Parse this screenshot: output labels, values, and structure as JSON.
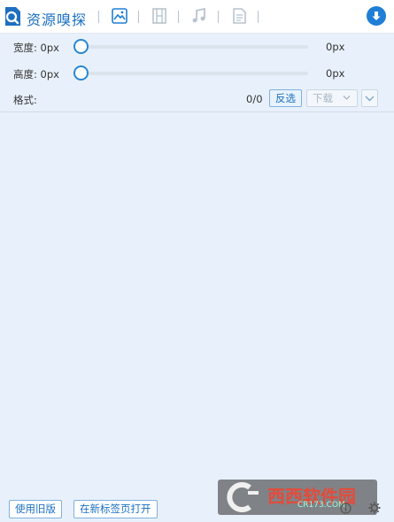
{
  "header": {
    "title": "资源嗅探",
    "tabs": [
      {
        "name": "image",
        "icon": "image-icon",
        "active": true
      },
      {
        "name": "video",
        "icon": "film-icon",
        "active": false
      },
      {
        "name": "audio",
        "icon": "music-icon",
        "active": false
      },
      {
        "name": "document",
        "icon": "document-icon",
        "active": false
      }
    ],
    "accent": "#1f7ed6"
  },
  "filters": {
    "width": {
      "label": "宽度: 0px",
      "value": "0px"
    },
    "height": {
      "label": "高度: 0px",
      "value": "0px"
    }
  },
  "format": {
    "label": "格式:",
    "count": "0/0",
    "invert_label": "反选",
    "download_label": "下载"
  },
  "footer": {
    "old_version_label": "使用旧版",
    "open_in_new_tab_label": "在新标签页打开"
  },
  "watermark": {
    "text": "西西软件园",
    "sub": "CR173.COM"
  }
}
